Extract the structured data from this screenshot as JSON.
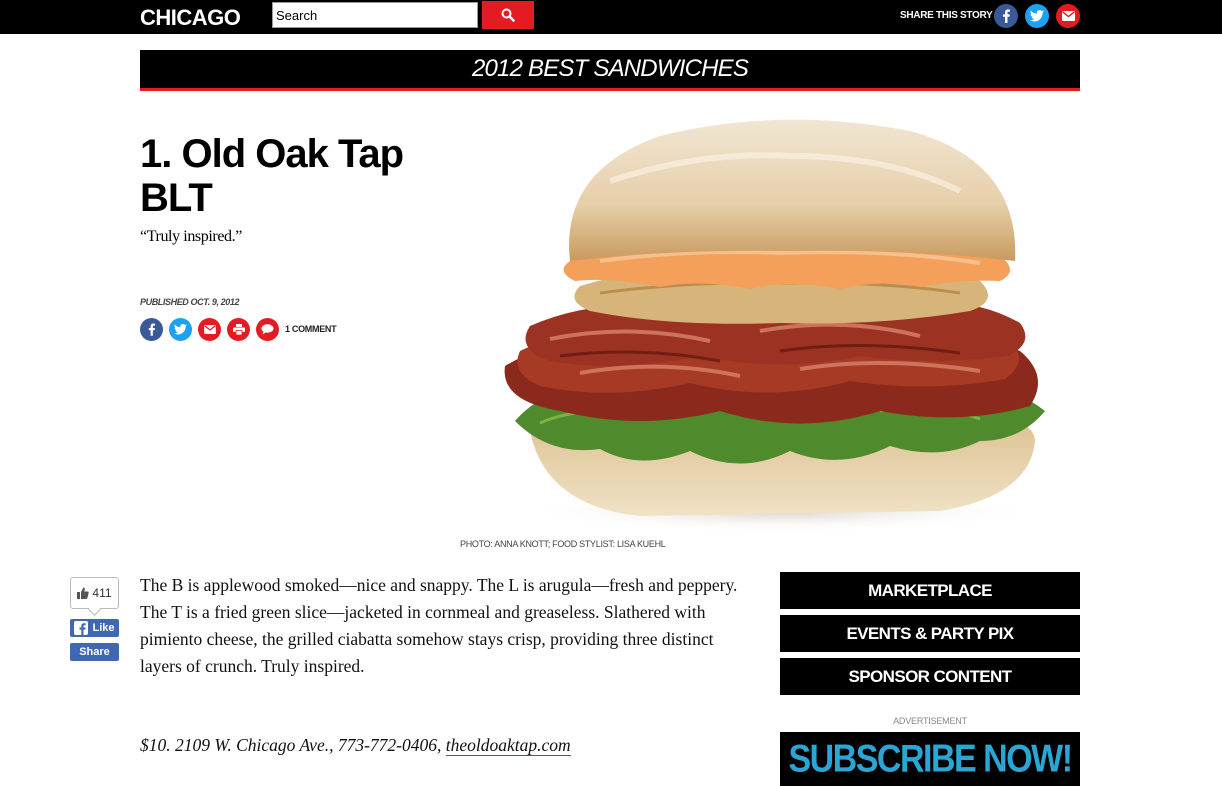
{
  "header": {
    "logo": "CHICAGO",
    "search_placeholder": "Search",
    "share_label": "SHARE THIS STORY"
  },
  "section_title": "2012 BEST SANDWICHES",
  "article": {
    "headline_line1": "1. Old Oak Tap",
    "headline_line2": "BLT",
    "dek": "“Truly inspired.”",
    "published": "PUBLISHED OCT. 9, 2012",
    "comment_count": "1 COMMENT",
    "photo_credit": "PHOTO: ANNA KNOTT; FOOD STYLIST: LISA KUEHL",
    "body": "The B is applewood smoked—nice and snappy. The L is arugula—fresh and peppery. The T is a fried green slice—jacketed in cornmeal and greaseless. Slathered with pimiento cheese, the grilled ciabatta somehow stays crisp, providing three distinct layers of crunch. Truly inspired.",
    "address": "$10. 2109 W. Chicago Ave., 773-772-0406, ",
    "website": "theoldoaktap.com"
  },
  "social": {
    "like_count": "411",
    "like_label": "Like",
    "share_label": "Share"
  },
  "rail": {
    "marketplace": "MARKETPLACE",
    "events": "EVENTS & PARTY PIX",
    "sponsor": "SPONSOR CONTENT",
    "ad_label": "ADVERTISEMENT",
    "subscribe": "SUBSCRIBE NOW!"
  },
  "colors": {
    "accent_red": "#e31b23",
    "facebook": "#3b5998",
    "twitter": "#1da1f2",
    "subscribe_blue": "#2aa6d6"
  },
  "icons": [
    "search-icon",
    "facebook-icon",
    "twitter-icon",
    "email-icon",
    "print-icon",
    "comment-icon",
    "thumbs-up-icon"
  ]
}
